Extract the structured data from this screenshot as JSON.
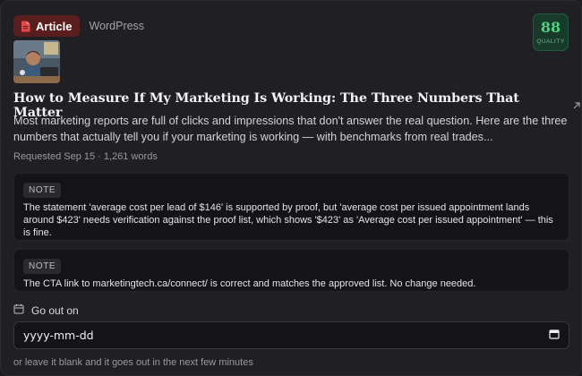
{
  "article_badge": {
    "label": "Article",
    "icon": "document-icon",
    "color": "#5a1e1e"
  },
  "source": "WordPress",
  "quality": {
    "score": "88",
    "label": "QUALITY",
    "color": "#4fd07f"
  },
  "thumbnail": {
    "icon": "article-thumbnail"
  },
  "title": "How to Measure If My Marketing Is Working: The Three Numbers That Matter",
  "title_link_icon": "external-link-icon",
  "excerpt": "Most marketing reports are full of clicks and impressions that don't answer the real question. Here are the three numbers that actually tell you if your marketing is working — with benchmarks from real trades...",
  "meta": "Requested Sep 15 · 1,261 words",
  "notes": [
    {
      "tag": "NOTE",
      "text": "The statement 'average cost per lead of $146' is supported by proof, but 'average cost per issued appointment lands around $423' needs verification against the proof list, which shows '$423' as 'Average cost per issued appointment' — this is fine."
    },
    {
      "tag": "NOTE",
      "text": "The CTA link to marketingtech.ca/connect/ is correct and matches the approved list. No change needed."
    }
  ],
  "schedule": {
    "label": "Go out on",
    "icon": "calendar-icon",
    "placeholder": "yyyy-mm-dd",
    "hint": "or leave it blank and it goes out in the next few minutes"
  }
}
